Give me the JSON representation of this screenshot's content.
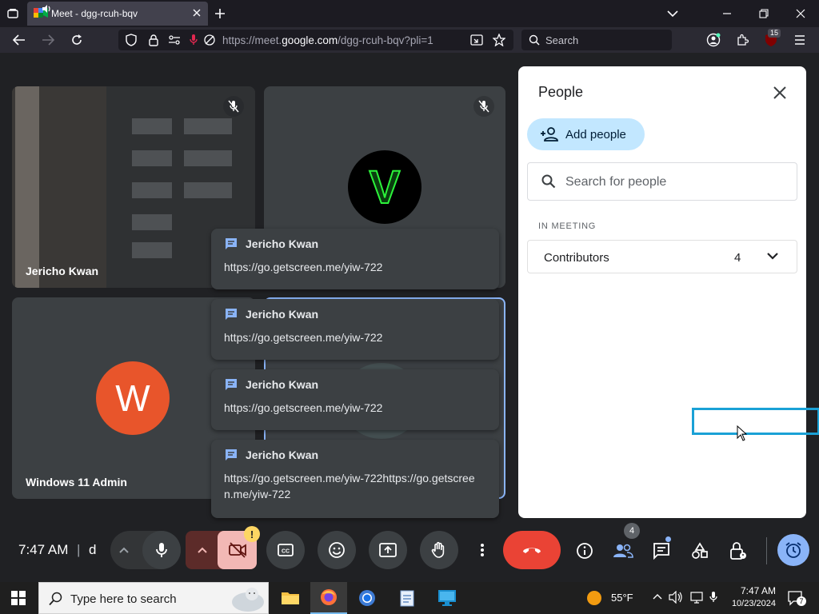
{
  "browser": {
    "tab_title": "Meet - dgg-rcuh-bqv",
    "url_prefix": "https://meet.",
    "url_host": "google.com",
    "url_path": "/dgg-rcuh-bqv?pli=1",
    "search_placeholder": "Search",
    "extension_badge": "15"
  },
  "tiles": [
    {
      "name": "Jericho Kwan",
      "muted": true
    },
    {
      "initial": "V",
      "muted": true
    },
    {
      "name": "Windows 11 Admin",
      "initial": "W"
    },
    {
      "active_speaker": true
    }
  ],
  "toasts": [
    {
      "sender": "Jericho Kwan",
      "message": "https://go.getscreen.me/yiw-722"
    },
    {
      "sender": "Jericho Kwan",
      "message": "https://go.getscreen.me/yiw-722"
    },
    {
      "sender": "Jericho Kwan",
      "message": "https://go.getscreen.me/yiw-722"
    },
    {
      "sender": "Jericho Kwan",
      "message": "https://go.getscreen.me/yiw-722https://go.getscreen.me/yiw-722"
    }
  ],
  "people_panel": {
    "title": "People",
    "add_people_label": "Add people",
    "search_placeholder": "Search for people",
    "section_label": "IN MEETING",
    "group_label": "Contributors",
    "group_count": "4"
  },
  "controls": {
    "time": "7:47 AM",
    "separator": "|",
    "meeting_code": "d",
    "camera_warning": "!",
    "people_count_badge": "4"
  },
  "taskbar": {
    "search_placeholder": "Type here to search",
    "temperature": "55°F",
    "time": "7:47 AM",
    "date": "10/23/2024",
    "notification_count": "7"
  },
  "colors": {
    "meet_bg": "#202124",
    "tile_bg": "#3c4043",
    "end_call": "#ea4335",
    "accent": "#8ab4f8",
    "avatar_w": "#e8552b",
    "avatar_v_glow": "#22d62f"
  }
}
